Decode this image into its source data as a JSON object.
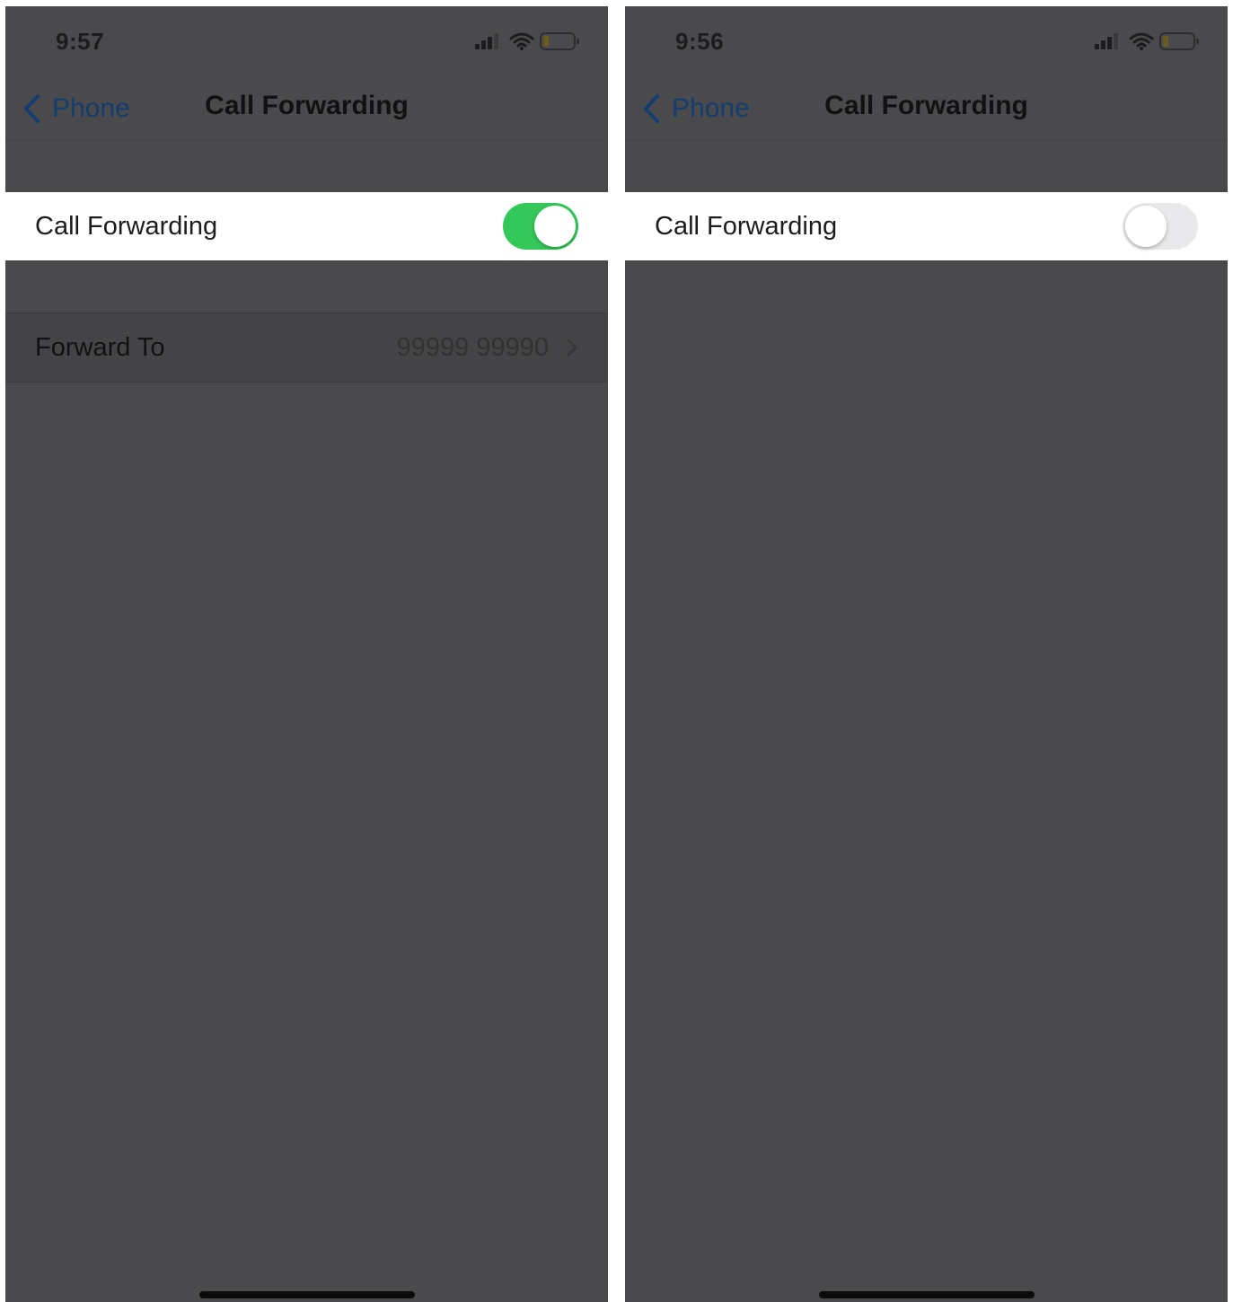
{
  "screens": [
    {
      "status": {
        "time": "9:57"
      },
      "nav": {
        "back_label": "Phone",
        "title": "Call Forwarding"
      },
      "toggle": {
        "label": "Call Forwarding",
        "state": "on"
      },
      "forward_to": {
        "label": "Forward To",
        "value": "99999 99990"
      }
    },
    {
      "status": {
        "time": "9:56"
      },
      "nav": {
        "back_label": "Phone",
        "title": "Call Forwarding"
      },
      "toggle": {
        "label": "Call Forwarding",
        "state": "off"
      }
    }
  ],
  "icons": {
    "signal": "cellular-signal-icon",
    "wifi": "wifi-icon",
    "battery": "battery-low-icon",
    "back": "chevron-left-icon",
    "disclosure": "chevron-right-icon"
  },
  "colors": {
    "dim_background": "#4a4a4c",
    "switch_on": "#34c759",
    "switch_off": "#e9e9eb",
    "link": "#123d6e"
  }
}
